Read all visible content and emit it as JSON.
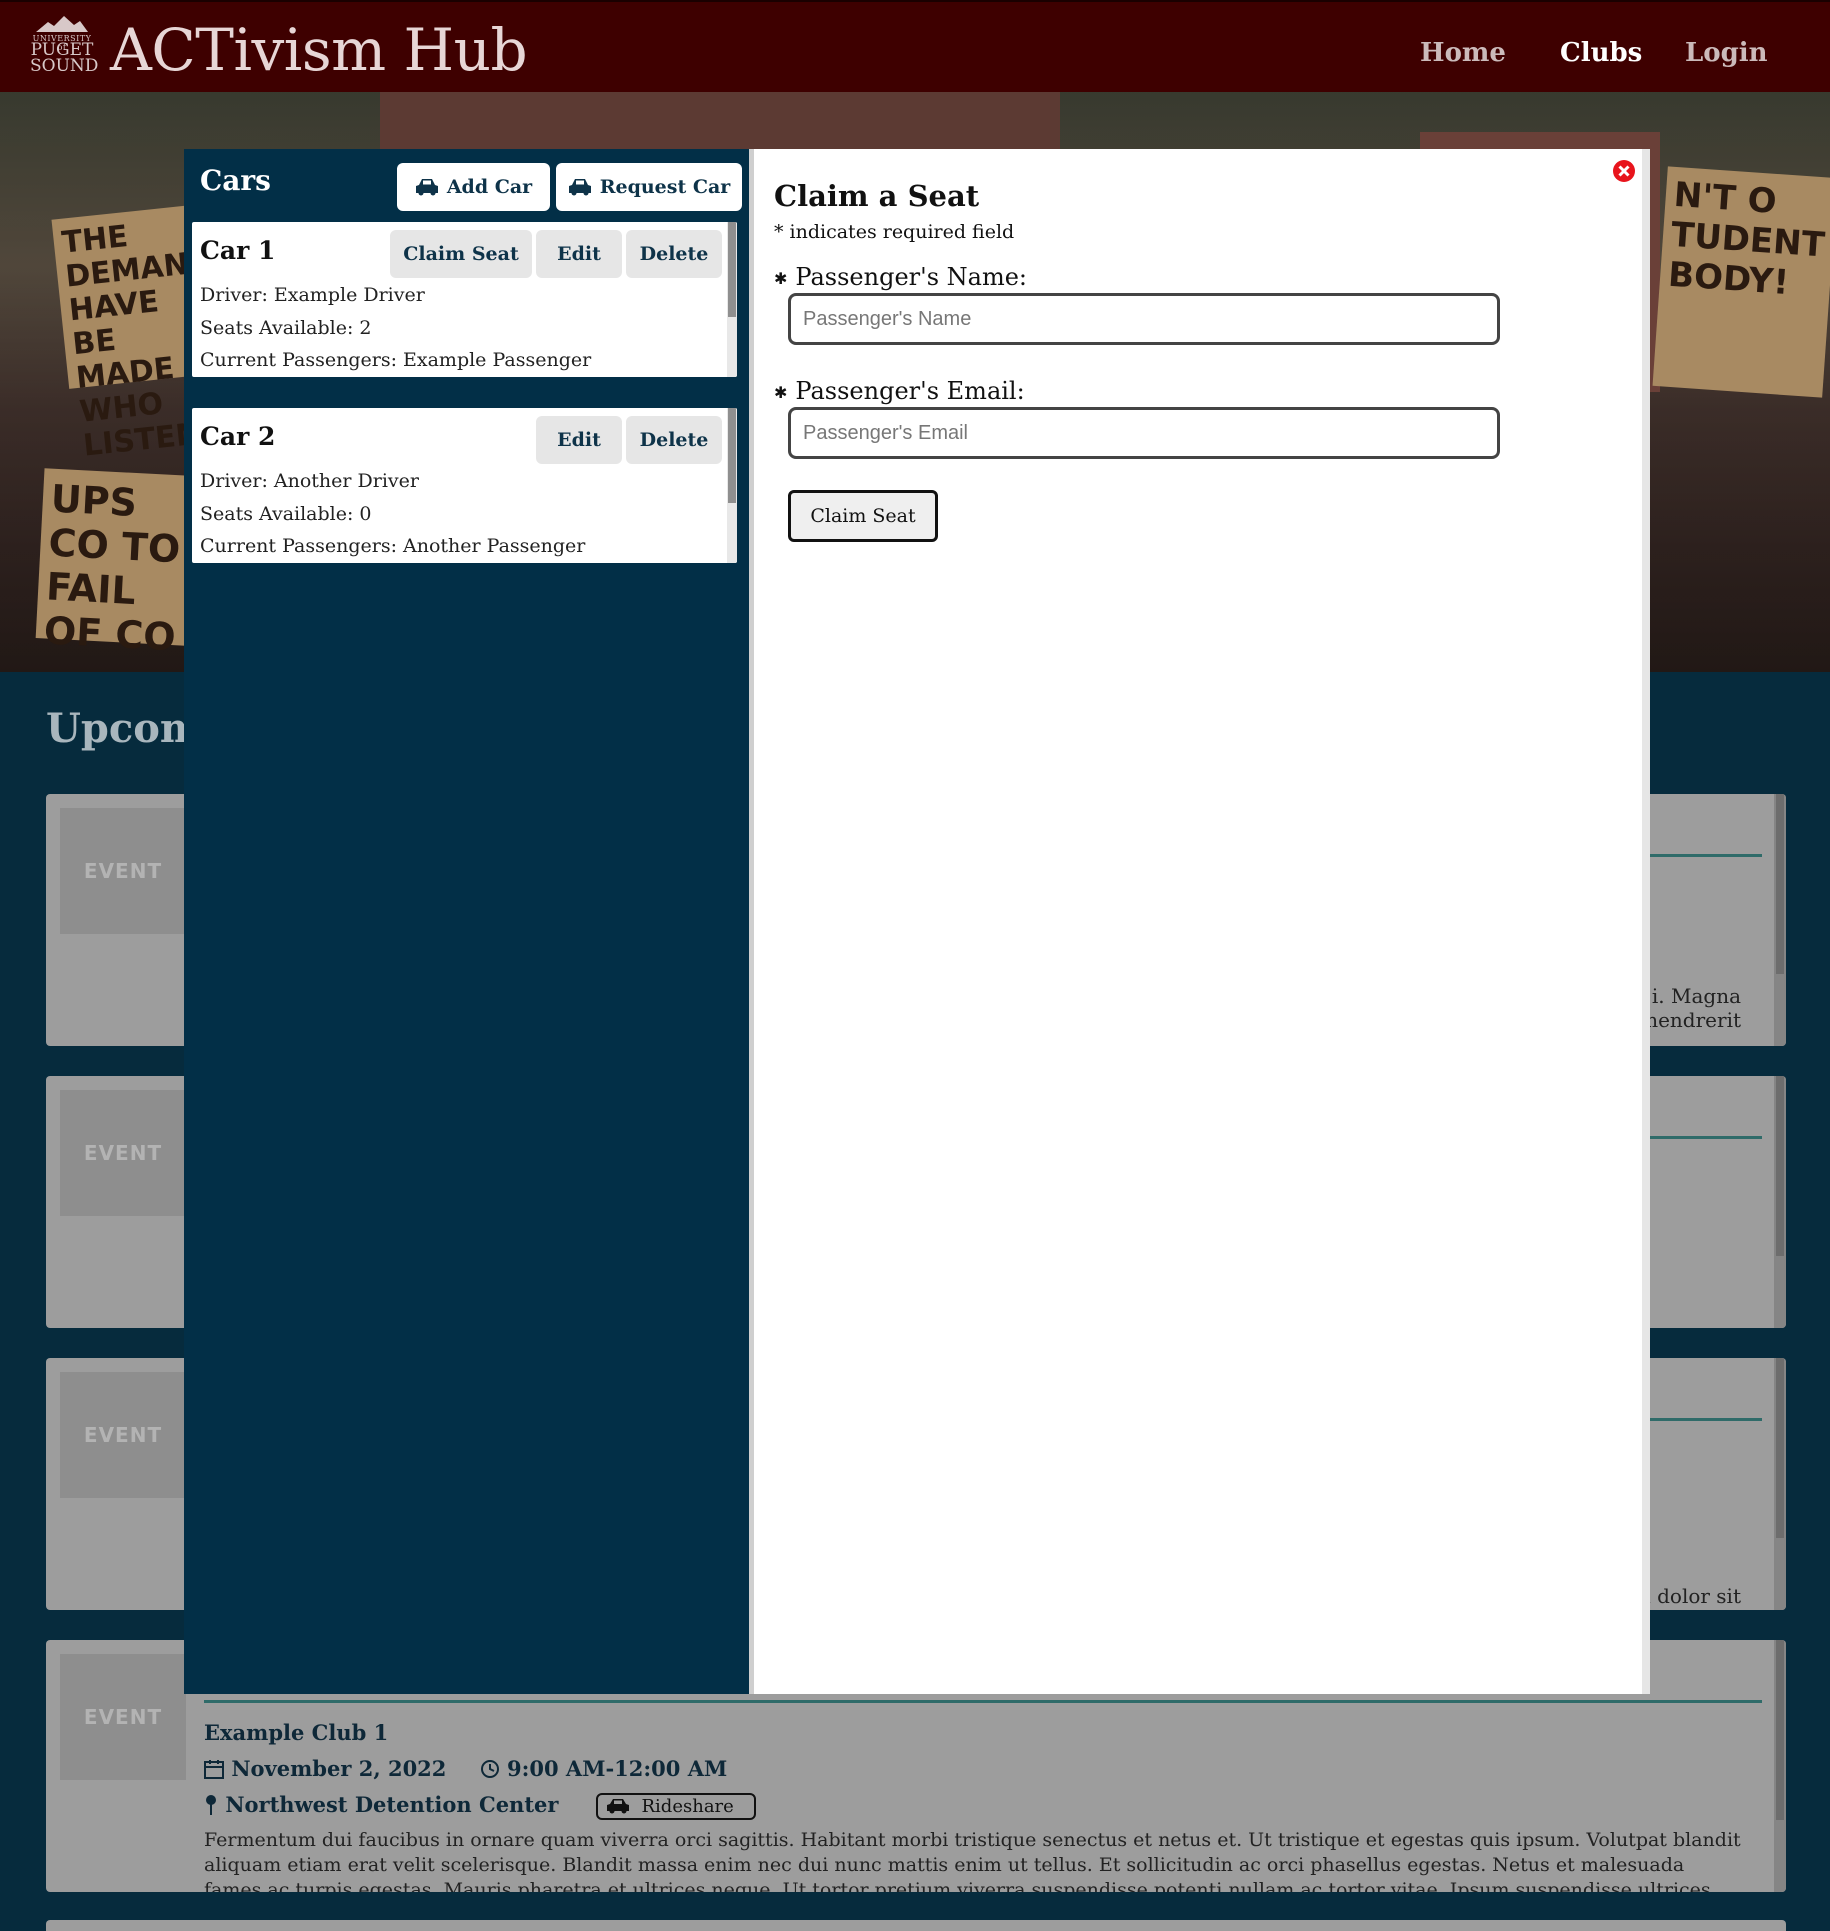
{
  "header": {
    "logo": {
      "line1": "UNIVERSITY of",
      "line2": "PUGET",
      "line3": "SOUND"
    },
    "site_title": "ACTivism Hub",
    "nav": [
      {
        "label": "Home",
        "active": false
      },
      {
        "label": "Clubs",
        "active": true
      },
      {
        "label": "Login",
        "active": false
      }
    ],
    "bar_color": "#3e0000"
  },
  "hero": {
    "signs": [
      "THE DEMAND HAVE BE MADE WHO LISTEN",
      "UPS CO TO FAIL OF CO",
      "N'T O TUDENT BODY!"
    ]
  },
  "page": {
    "section_heading": "Upcomi",
    "event_thumb_label": "EVENT",
    "fragments": {
      "card1_line1": "i. Magna",
      "card1_line2": "n hendrerit",
      "card3_line1": "um dolor sit"
    },
    "event4": {
      "title": "Example Club 1",
      "date": "November 2, 2022",
      "time": "9:00 AM-12:00 AM",
      "location": "Northwest Detention Center",
      "rideshare_label": "Rideshare",
      "description": "Fermentum dui faucibus in ornare quam viverra orci sagittis. Habitant morbi tristique senectus et netus et. Ut tristique et egestas quis ipsum. Volutpat blandit aliquam etiam erat velit scelerisque. Blandit massa enim nec dui nunc mattis enim ut tellus. Et sollicitudin ac orci phasellus egestas. Netus et malesuada fames ac turpis egestas. Mauris pharetra et ultrices neque. Ut tortor pretium viverra suspendisse potenti nullam ac tortor vitae. Ipsum suspendisse ultrices gravida dictum fusce. Cras fermentum odio eu feugiat pretium. Dignissim enim sit"
    }
  },
  "cars_panel": {
    "title": "Cars",
    "add_car_label": "Add Car",
    "request_car_label": "Request Car",
    "cars": [
      {
        "name": "Car 1",
        "claim_label": "Claim Seat",
        "edit_label": "Edit",
        "delete_label": "Delete",
        "driver": "Driver: Example Driver",
        "seats": "Seats Available: 2",
        "passengers": "Current Passengers: Example Passenger"
      },
      {
        "name": "Car 2",
        "edit_label": "Edit",
        "delete_label": "Delete",
        "driver": "Driver: Another Driver",
        "seats": "Seats Available: 0",
        "passengers": "Current Passengers: Another Passenger"
      }
    ]
  },
  "claim_modal": {
    "title": "Claim a Seat",
    "required_note": "* indicates required field",
    "name_label": "Passenger's Name:",
    "name_placeholder": "Passenger's Name",
    "email_label": "Passenger's Email:",
    "email_placeholder": "Passenger's Email",
    "submit_label": "Claim Seat",
    "close_icon": "close-circle-icon",
    "close_color": "#e8141c"
  },
  "colors": {
    "panel_bg": "#022f47",
    "accent_rule": "#2f6b69"
  }
}
